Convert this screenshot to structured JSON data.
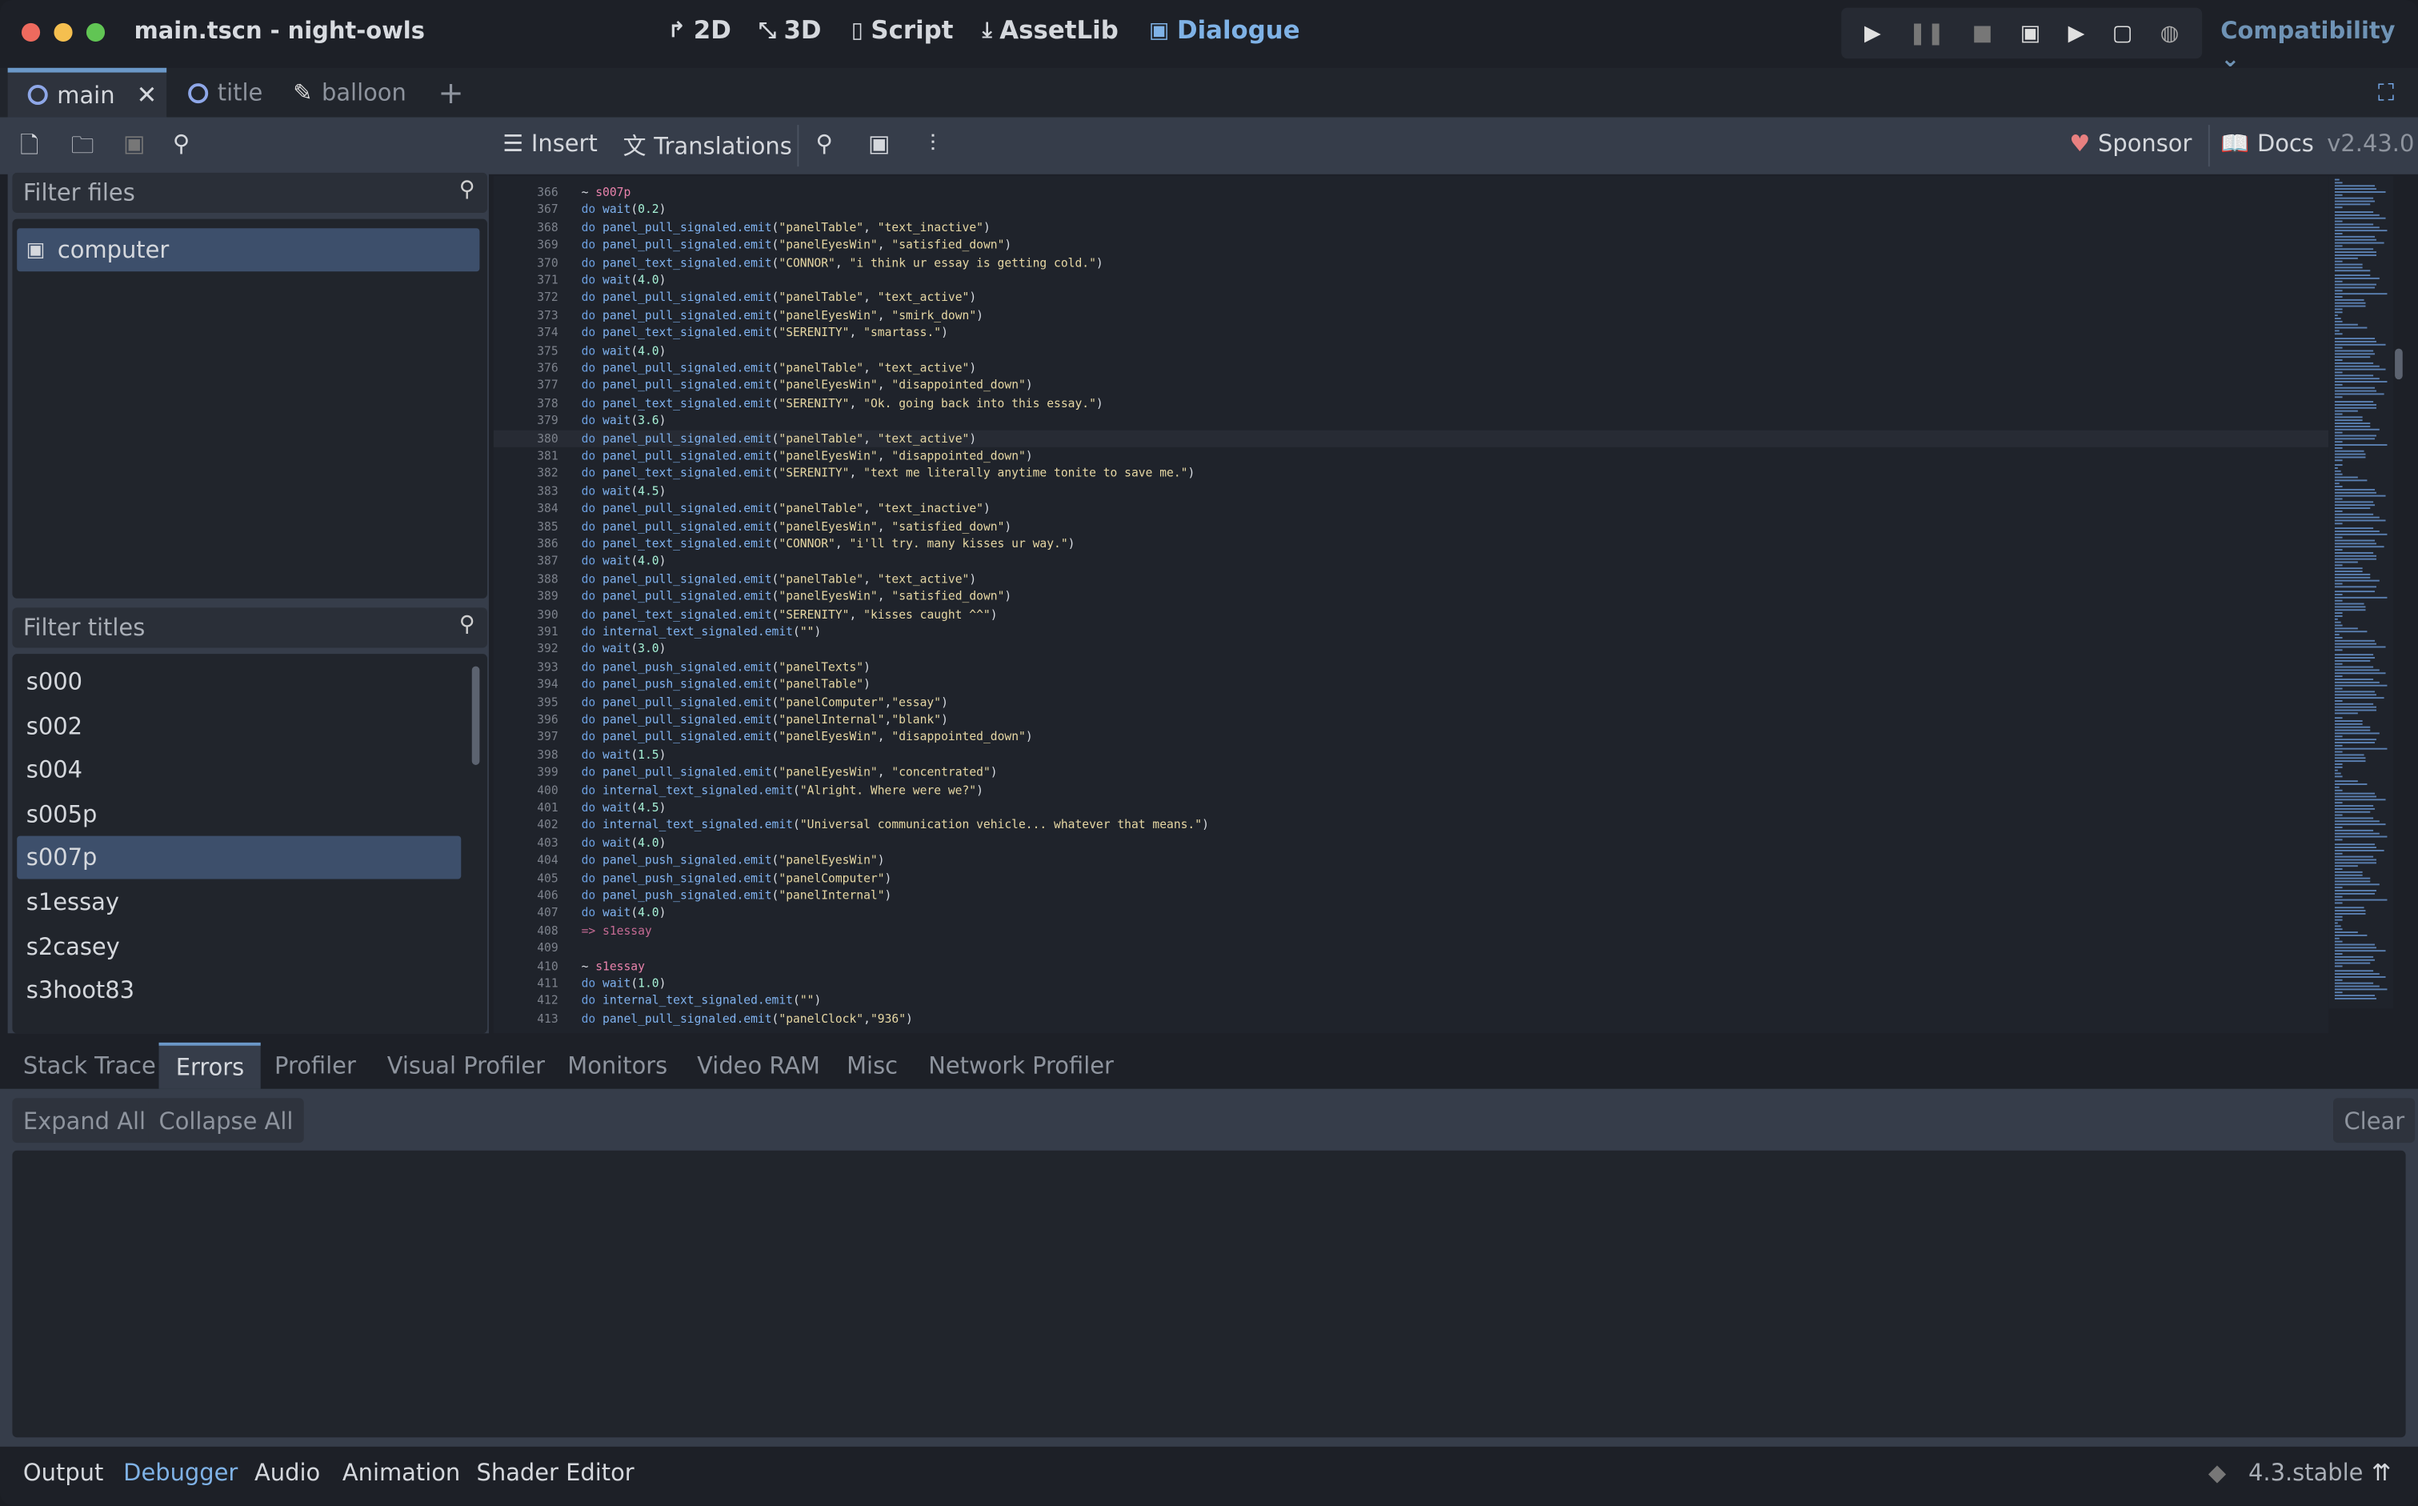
{
  "window": {
    "title": "main.tscn - night-owls"
  },
  "workspaces": [
    {
      "label": "2D",
      "icon": "2d-icon"
    },
    {
      "label": "3D",
      "icon": "3d-icon"
    },
    {
      "label": "Script",
      "icon": "script-icon"
    },
    {
      "label": "AssetLib",
      "icon": "assetlib-icon"
    },
    {
      "label": "Dialogue",
      "icon": "dialogue-icon",
      "active": true
    }
  ],
  "renderer": "Compatibility",
  "scene_tabs": [
    {
      "label": "main",
      "active": true
    },
    {
      "label": "title"
    },
    {
      "label": "balloon"
    }
  ],
  "toolbar": {
    "insert": "Insert",
    "translations": "Translations",
    "sponsor": "Sponsor",
    "docs": "Docs",
    "version": "v2.43.0"
  },
  "files": {
    "placeholder": "Filter files",
    "items": [
      "computer"
    ],
    "selected": "computer"
  },
  "titles": {
    "placeholder": "Filter titles",
    "items": [
      "s000",
      "s002",
      "s004",
      "s005p",
      "s007p",
      "s1essay",
      "s2casey",
      "s3hoot83"
    ],
    "selected": "s007p"
  },
  "editor": {
    "first_line": 366,
    "current_line": 380,
    "lines": [
      "~ s007p",
      "do wait(0.2)",
      "do panel_pull_signaled.emit(\"panelTable\", \"text_inactive\")",
      "do panel_pull_signaled.emit(\"panelEyesWin\", \"satisfied_down\")",
      "do panel_text_signaled.emit(\"CONNOR\", \"i think ur essay is getting cold.\")",
      "do wait(4.0)",
      "do panel_pull_signaled.emit(\"panelTable\", \"text_active\")",
      "do panel_pull_signaled.emit(\"panelEyesWin\", \"smirk_down\")",
      "do panel_text_signaled.emit(\"SERENITY\", \"smartass.\")",
      "do wait(4.0)",
      "do panel_pull_signaled.emit(\"panelTable\", \"text_active\")",
      "do panel_pull_signaled.emit(\"panelEyesWin\", \"disappointed_down\")",
      "do panel_text_signaled.emit(\"SERENITY\", \"Ok. going back into this essay.\")",
      "do wait(3.6)",
      "do panel_pull_signaled.emit(\"panelTable\", \"text_active\")",
      "do panel_pull_signaled.emit(\"panelEyesWin\", \"disappointed_down\")",
      "do panel_text_signaled.emit(\"SERENITY\", \"text me literally anytime tonite to save me.\")",
      "do wait(4.5)",
      "do panel_pull_signaled.emit(\"panelTable\", \"text_inactive\")",
      "do panel_pull_signaled.emit(\"panelEyesWin\", \"satisfied_down\")",
      "do panel_text_signaled.emit(\"CONNOR\", \"i'll try. many kisses ur way.\")",
      "do wait(4.0)",
      "do panel_pull_signaled.emit(\"panelTable\", \"text_active\")",
      "do panel_pull_signaled.emit(\"panelEyesWin\", \"satisfied_down\")",
      "do panel_text_signaled.emit(\"SERENITY\", \"kisses caught ^^\")",
      "do internal_text_signaled.emit(\"\")",
      "do wait(3.0)",
      "do panel_push_signaled.emit(\"panelTexts\")",
      "do panel_push_signaled.emit(\"panelTable\")",
      "do panel_pull_signaled.emit(\"panelComputer\",\"essay\")",
      "do panel_pull_signaled.emit(\"panelInternal\",\"blank\")",
      "do panel_pull_signaled.emit(\"panelEyesWin\", \"disappointed_down\")",
      "do wait(1.5)",
      "do panel_pull_signaled.emit(\"panelEyesWin\", \"concentrated\")",
      "do internal_text_signaled.emit(\"Alright. Where were we?\")",
      "do wait(4.5)",
      "do internal_text_signaled.emit(\"Universal communication vehicle... whatever that means.\")",
      "do wait(4.0)",
      "do panel_push_signaled.emit(\"panelEyesWin\")",
      "do panel_push_signaled.emit(\"panelComputer\")",
      "do panel_push_signaled.emit(\"panelInternal\")",
      "do wait(4.0)",
      "=> s1essay",
      "",
      "~ s1essay",
      "do wait(1.0)",
      "do internal_text_signaled.emit(\"\")",
      "do panel_pull_signaled.emit(\"panelClock\",\"936\")"
    ]
  },
  "debugger_tabs": [
    {
      "label": "Stack Trace"
    },
    {
      "label": "Errors",
      "active": true
    },
    {
      "label": "Profiler"
    },
    {
      "label": "Visual Profiler"
    },
    {
      "label": "Monitors"
    },
    {
      "label": "Video RAM"
    },
    {
      "label": "Misc"
    },
    {
      "label": "Network Profiler"
    }
  ],
  "errors_panel": {
    "expand_all": "Expand All",
    "collapse_all": "Collapse All",
    "clear": "Clear"
  },
  "bottom_tabs": [
    {
      "label": "Output"
    },
    {
      "label": "Debugger",
      "active": true
    },
    {
      "label": "Audio"
    },
    {
      "label": "Animation"
    },
    {
      "label": "Shader Editor"
    }
  ],
  "engine_version": "4.3.stable",
  "colors": {
    "accent": "#6b98c8",
    "selection": "#3d4f6b",
    "dialogue_active": "#7fb2e6",
    "sponsor_heart": "#e88080"
  }
}
